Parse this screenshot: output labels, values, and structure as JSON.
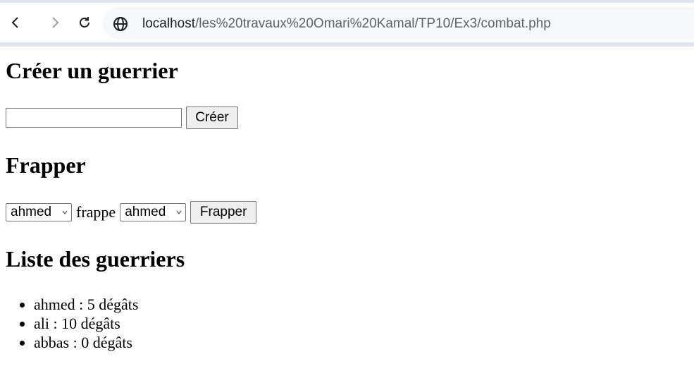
{
  "browser": {
    "url_host": "localhost",
    "url_path": "/les%20travaux%20Omari%20Kamal/TP10/Ex3/combat.php"
  },
  "create_section": {
    "heading": "Créer un guerrier",
    "input_value": "",
    "button_label": "Créer"
  },
  "hit_section": {
    "heading": "Frapper",
    "attacker_selected": "ahmed",
    "verb": "frappe",
    "target_selected": "ahmed",
    "button_label": "Frapper"
  },
  "list_section": {
    "heading": "Liste des guerriers",
    "warriors": [
      {
        "text": "ahmed : 5 dégâts"
      },
      {
        "text": "ali : 10 dégâts"
      },
      {
        "text": "abbas : 0 dégâts"
      }
    ]
  }
}
